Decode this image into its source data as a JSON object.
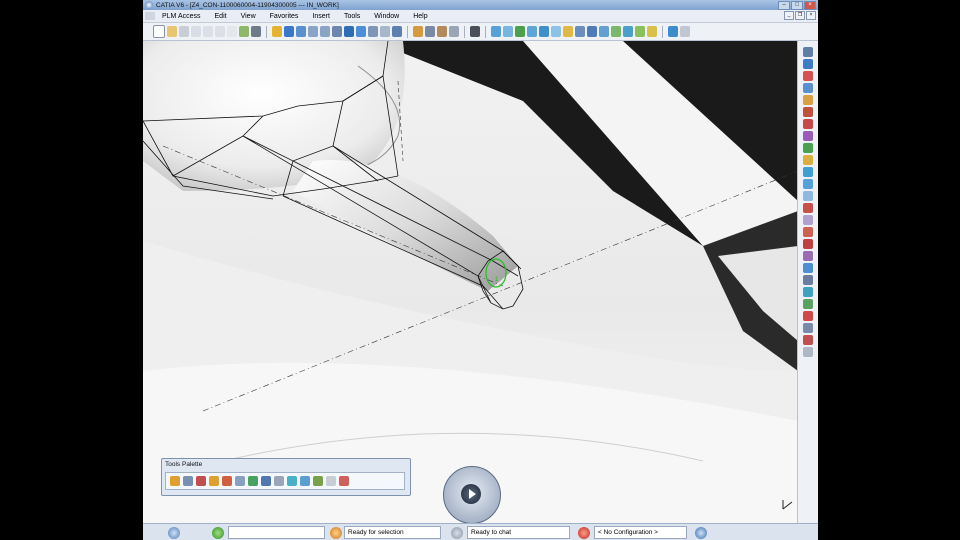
{
  "window": {
    "title": "CATIA V6 - [Z4_CON-1100060004-11904300005 --- IN_WORK]"
  },
  "menu": {
    "items": [
      "PLM Access",
      "Edit",
      "View",
      "Favorites",
      "Insert",
      "Tools",
      "Window",
      "Help"
    ]
  },
  "palette": {
    "title": "Tools Palette"
  },
  "status": {
    "selection": "Ready for selection",
    "chat": "Ready to chat",
    "configuration": "< No Configuration >"
  },
  "colors": {
    "accent": "#2f6db5",
    "highlight_green": "#22c022",
    "chrome": "#e9eef6"
  }
}
